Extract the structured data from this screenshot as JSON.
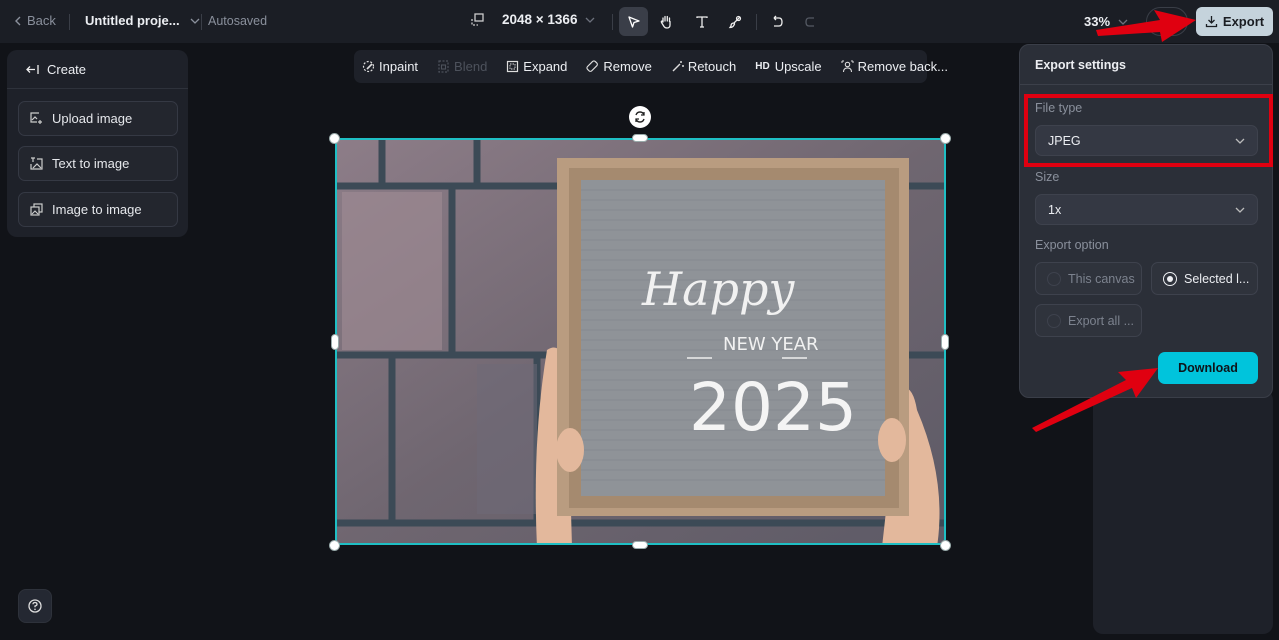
{
  "topbar": {
    "back_label": "Back",
    "project_title": "Untitled proje...",
    "save_status": "Autosaved",
    "canvas_size": "2048 × 1366",
    "zoom_level": "33%",
    "export_label": "Export",
    "tools": [
      {
        "name": "select",
        "icon": "cursor-icon",
        "active": true
      },
      {
        "name": "hand",
        "icon": "hand-icon",
        "active": false
      },
      {
        "name": "text",
        "icon": "text-icon",
        "active": false
      },
      {
        "name": "brush",
        "icon": "brush-icon",
        "active": false
      },
      {
        "name": "undo",
        "icon": "undo-icon",
        "active": false
      },
      {
        "name": "redo",
        "icon": "redo-icon",
        "active": false,
        "disabled": true
      }
    ]
  },
  "left_panel": {
    "header": "Create",
    "items": [
      {
        "label": "Upload image",
        "icon": "upload-image-icon"
      },
      {
        "label": "Text to image",
        "icon": "text-to-image-icon"
      },
      {
        "label": "Image to image",
        "icon": "image-to-image-icon"
      }
    ]
  },
  "ai_toolbar": {
    "items": [
      {
        "label": "Inpaint",
        "icon": "inpaint-icon",
        "disabled": false
      },
      {
        "label": "Blend",
        "icon": "blend-icon",
        "disabled": true
      },
      {
        "label": "Expand",
        "icon": "expand-icon",
        "disabled": false
      },
      {
        "label": "Remove",
        "icon": "eraser-icon",
        "disabled": false
      },
      {
        "label": "Retouch",
        "icon": "magic-wand-icon",
        "disabled": false
      },
      {
        "label": "Upscale",
        "icon": "hd-icon",
        "prefix": "HD",
        "disabled": false
      },
      {
        "label": "Remove back...",
        "icon": "remove-background-icon",
        "disabled": false
      }
    ]
  },
  "canvas": {
    "image_text": {
      "line1": "Happy",
      "line2": "NEW YEAR",
      "line3": "2025"
    },
    "selection_color": "#1fbfc4"
  },
  "export_panel": {
    "title": "Export settings",
    "file_type_label": "File type",
    "file_type_value": "JPEG",
    "size_label": "Size",
    "size_value": "1x",
    "export_option_label": "Export option",
    "options": [
      {
        "label": "This canvas",
        "selected": false
      },
      {
        "label": "Selected l...",
        "selected": true
      },
      {
        "label": "Export all ...",
        "selected": false
      }
    ],
    "download_label": "Download",
    "accent_color": "#00c4dc"
  },
  "annotations": {
    "highlight_color": "#e00010"
  }
}
